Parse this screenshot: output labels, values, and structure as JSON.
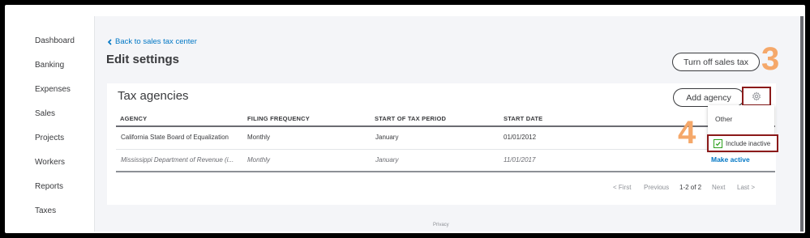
{
  "sidebar": {
    "items": [
      {
        "label": "Dashboard"
      },
      {
        "label": "Banking"
      },
      {
        "label": "Expenses"
      },
      {
        "label": "Sales"
      },
      {
        "label": "Projects"
      },
      {
        "label": "Workers"
      },
      {
        "label": "Reports"
      },
      {
        "label": "Taxes"
      }
    ]
  },
  "header": {
    "back_link": "Back to sales tax center",
    "title": "Edit settings",
    "turn_off_button": "Turn off sales tax"
  },
  "annotations": {
    "step_gear": "3",
    "step_checkbox": "4",
    "highlight_color": "#8b1a1a",
    "number_color": "#f5a86a"
  },
  "tax_agencies": {
    "title": "Tax agencies",
    "add_button": "Add agency",
    "columns": [
      "AGENCY",
      "FILING FREQUENCY",
      "START OF TAX PERIOD",
      "START DATE"
    ],
    "rows": [
      {
        "agency": "California State Board of Equalization",
        "frequency": "Monthly",
        "period": "January",
        "start_date": "01/01/2012",
        "action": ""
      },
      {
        "agency": "Mississippi Department of Revenue (i...",
        "frequency": "Monthly",
        "period": "January",
        "start_date": "11/01/2017",
        "action": "Make active"
      }
    ]
  },
  "pagination": {
    "first": "< First",
    "previous": "Previous",
    "range": "1-2 of 2",
    "next": "Next",
    "last": "Last >"
  },
  "settings_menu": {
    "gear_icon": "gear-icon",
    "heading": "Other",
    "include_inactive_label": "Include inactive",
    "include_inactive_checked": true
  },
  "footer": {
    "text": "Privacy"
  },
  "colors": {
    "link": "#0077c5",
    "check": "#2ca01c"
  }
}
